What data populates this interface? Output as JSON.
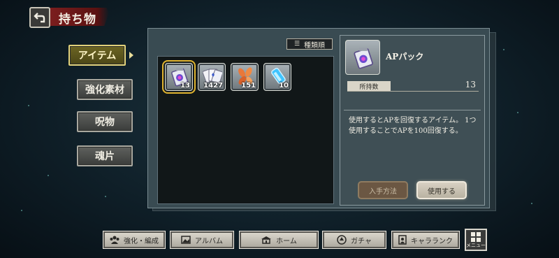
{
  "header": {
    "title": "持ち物"
  },
  "tabs": [
    {
      "label": "アイテム",
      "active": true
    },
    {
      "label": "強化素材",
      "active": false
    },
    {
      "label": "呪物",
      "active": false
    },
    {
      "label": "魂片",
      "active": false
    }
  ],
  "sort": {
    "label": "種類順"
  },
  "items": [
    {
      "icon": "ap-pack-icon",
      "count": "13",
      "selected": true
    },
    {
      "icon": "cards-icon",
      "count": "1427",
      "selected": false
    },
    {
      "icon": "petals-icon",
      "count": "151",
      "selected": false
    },
    {
      "icon": "crystal-vial-icon",
      "count": "10",
      "selected": false
    }
  ],
  "detail": {
    "name": "APパック",
    "owned_label": "所持数",
    "owned_value": "13",
    "description": "使用するとAPを回復するアイテム。 1つ使用することでAPを100回復する。"
  },
  "actions": {
    "obtain": "入手方法",
    "use": "使用する"
  },
  "nav": [
    {
      "label": "強化・編成",
      "icon": "party-icon"
    },
    {
      "label": "アルバム",
      "icon": "album-icon"
    },
    {
      "label": "ホーム",
      "icon": "home-icon"
    },
    {
      "label": "ガチャ",
      "icon": "gacha-icon"
    },
    {
      "label": "キャラランク",
      "icon": "character-rank-icon"
    }
  ],
  "menu": {
    "label": "メニュー"
  },
  "colors": {
    "active_tab": "#6c6523",
    "title_banner": "#7b1e1e",
    "selection": "#e0b430"
  }
}
